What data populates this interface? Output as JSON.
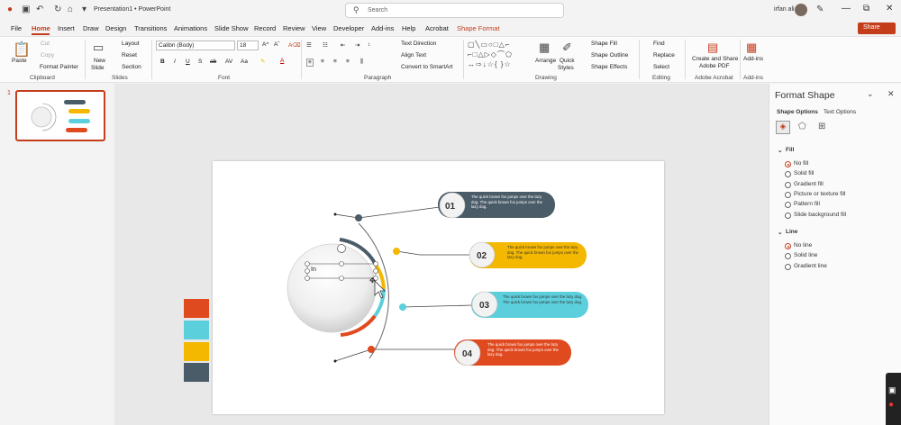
{
  "titlebar": {
    "autosave_icon": "powerpoint-logo",
    "doc_title": "Presentation1 • PowerPoint",
    "search_placeholder": "Search",
    "user_name": "irfan ali",
    "minimize": "—",
    "restore": "⧉",
    "close": "✕"
  },
  "tabs": [
    "File",
    "Home",
    "Insert",
    "Draw",
    "Design",
    "Transitions",
    "Animations",
    "Slide Show",
    "Record",
    "Review",
    "View",
    "Developer",
    "Add-ins",
    "Help",
    "Acrobat",
    "Shape Format"
  ],
  "share_label": "Share",
  "ribbon": {
    "clipboard": {
      "paste": "Paste",
      "cut": "Cut",
      "copy": "Copy",
      "format_painter": "Format Painter",
      "label": "Clipboard"
    },
    "slides": {
      "new_slide": "New",
      "new_slide2": "Slide",
      "layout": "Layout",
      "reset": "Reset",
      "section": "Section",
      "label": "Slides"
    },
    "font": {
      "font_name": "Calibri (Body)",
      "font_size": "18",
      "label": "Font"
    },
    "paragraph": {
      "text_direction": "Text Direction",
      "align_text": "Align Text",
      "convert_smartart": "Convert to SmartArt",
      "label": "Paragraph"
    },
    "drawing": {
      "arrange": "Arrange",
      "quick_styles": "Quick",
      "quick_styles2": "Styles",
      "shape_fill": "Shape Fill",
      "shape_outline": "Shape Outline",
      "shape_effects": "Shape Effects",
      "label": "Drawing"
    },
    "editing": {
      "find": "Find",
      "replace": "Replace",
      "select": "Select",
      "label": "Editing"
    },
    "acrobat": {
      "create_share": "Create and Share",
      "create_share2": "Adobe PDF",
      "label": "Adobe Acrobat"
    },
    "addins": {
      "addins": "Add-ins",
      "label": "Add-ins"
    }
  },
  "thumbnail_number": "1",
  "slide": {
    "textbox_text": "In",
    "items": [
      {
        "num": "01",
        "text": "The quick brown fox jumps over the lazy dog. The quick brown fox jumps over the lazy dog.",
        "color": "#4a5c68"
      },
      {
        "num": "02",
        "text": "The quick brown fox jumps over the lazy dog. The quick brown fox jumps over the lazy dog.",
        "color": "#f5b800"
      },
      {
        "num": "03",
        "text": "The quick brown fox jumps over the lazy dog. The quick brown fox jumps over the lazy dog.",
        "color": "#5ccfdc"
      },
      {
        "num": "04",
        "text": "The quick brown fox jumps over the lazy dog. The quick brown fox jumps over the lazy dog.",
        "color": "#e04a1f"
      }
    ],
    "swatches": [
      "#e04a1f",
      "#5ccfdc",
      "#f5b800",
      "#4a5c68"
    ]
  },
  "format_pane": {
    "title": "Format Shape",
    "tab_shape": "Shape Options",
    "tab_text": "Text Options",
    "fill_section": "Fill",
    "fill_options": [
      "No fill",
      "Solid fill",
      "Gradient fill",
      "Picture or texture fill",
      "Pattern fill",
      "Slide background fill"
    ],
    "fill_selected": 0,
    "line_section": "Line",
    "line_options": [
      "No line",
      "Solid line",
      "Gradient line"
    ],
    "line_selected": 0
  }
}
